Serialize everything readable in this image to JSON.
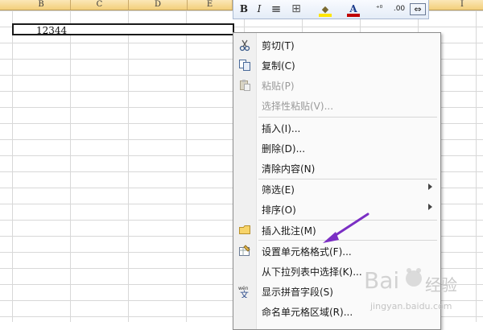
{
  "columns": [
    "B",
    "C",
    "D",
    "E",
    "I"
  ],
  "cell": {
    "value": "12344"
  },
  "mini_toolbar": {
    "bold": "B",
    "italic": "I",
    "align": "≡",
    "border": "⊞",
    "fill": "◆",
    "font_color": "A",
    "increase_decimal": "⁺⁰",
    "decrease_decimal": ".00",
    "merge": "⇔"
  },
  "menu": {
    "items": [
      {
        "label": "剪切(T)",
        "icon": "scissors-icon",
        "enabled": true
      },
      {
        "label": "复制(C)",
        "icon": "copy-icon",
        "enabled": true
      },
      {
        "label": "粘贴(P)",
        "icon": "paste-icon",
        "enabled": false
      },
      {
        "label": "选择性粘贴(V)...",
        "icon": "",
        "enabled": false
      },
      {
        "label": "插入(I)...",
        "icon": "",
        "enabled": true
      },
      {
        "label": "删除(D)...",
        "icon": "",
        "enabled": true
      },
      {
        "label": "清除内容(N)",
        "icon": "",
        "enabled": true
      },
      {
        "label": "筛选(E)",
        "icon": "",
        "enabled": true,
        "submenu": true
      },
      {
        "label": "排序(O)",
        "icon": "",
        "enabled": true,
        "submenu": true
      },
      {
        "label": "插入批注(M)",
        "icon": "comment-icon",
        "enabled": true
      },
      {
        "label": "设置单元格格式(F)...",
        "icon": "format-cells-icon",
        "enabled": true
      },
      {
        "label": "从下拉列表中选择(K)...",
        "icon": "",
        "enabled": true
      },
      {
        "label": "显示拼音字段(S)",
        "icon": "phonetic-icon",
        "enabled": true
      },
      {
        "label": "命名单元格区域(R)...",
        "icon": "",
        "enabled": true
      }
    ]
  },
  "watermark": {
    "brand": "Baidu 经验",
    "url": "jingyan.baidu.com"
  },
  "colors": {
    "header": "#f3cf7a",
    "accent_arrow": "#7b2fc4",
    "font_red": "#c00000",
    "fill_yellow": "#ffe600"
  }
}
